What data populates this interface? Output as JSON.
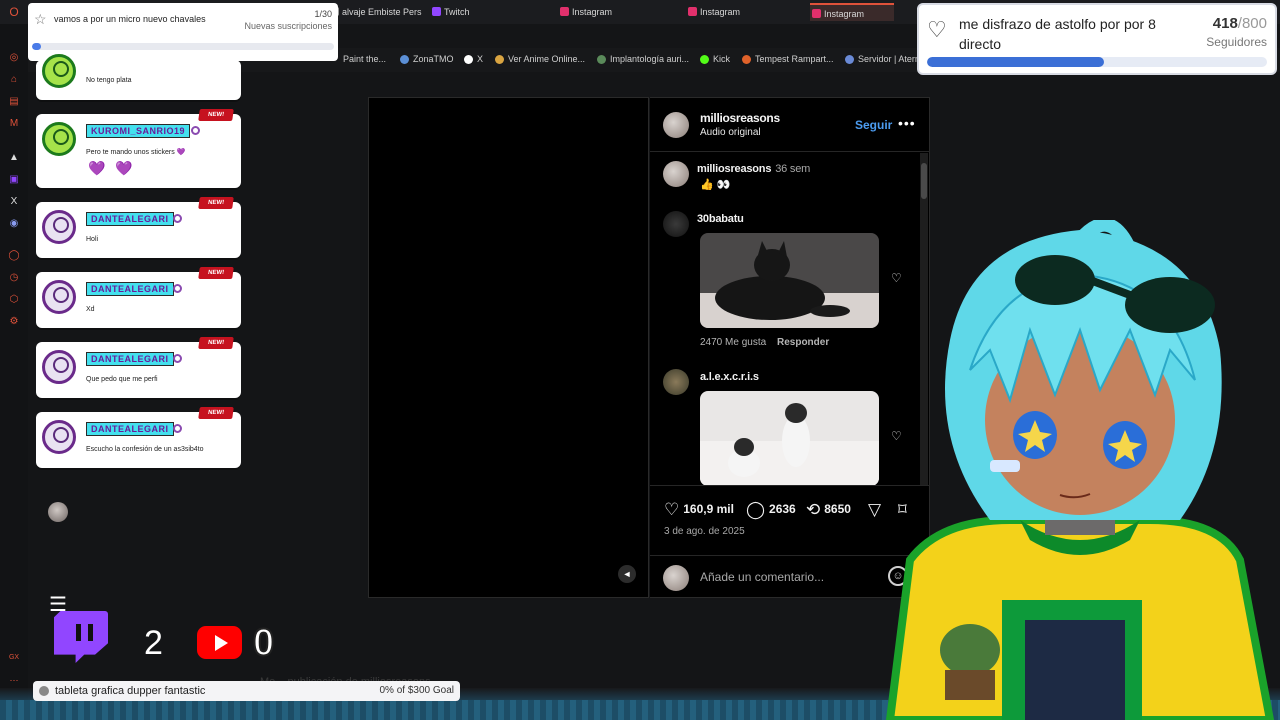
{
  "browser": {
    "tabs": [
      {
        "label": "alvaje Embiste Pers",
        "color": "#9a9a9a"
      },
      {
        "label": "Twitch",
        "color": "#9146ff"
      },
      {
        "label": "Instagram",
        "color": "#e1306c"
      },
      {
        "label": "Instagram",
        "color": "#e1306c"
      },
      {
        "label": "Instagram",
        "color": "#e1306c",
        "active": true
      }
    ],
    "bookmarks": [
      "Paint the...",
      "ZonaTMO",
      "X",
      "Ver Anime Online...",
      "Implantología auri...",
      "Kick",
      "Tempest Rampart...",
      "Servidor | Atern"
    ]
  },
  "follower_goal": {
    "title": "vamos a por un micro nuevo chavales",
    "count": "1/30",
    "subtitle": "Nuevas suscripciones",
    "progress": 0.03
  },
  "subs_goal": {
    "title": "me disfrazo de astolfo por por 8 directo",
    "current": "418",
    "total": "/800",
    "subtitle": "Seguidores",
    "progress": 0.52
  },
  "chat": {
    "new_badge": "NEW!",
    "messages": [
      {
        "user": "",
        "text": "No tengo plata"
      },
      {
        "user": "KUROMI_SANRIO19",
        "text": "Pero te mando unos stickers 💜",
        "extra": "💜 💜"
      },
      {
        "user": "DANTEALEGARI",
        "text": "Holi"
      },
      {
        "user": "DANTEALEGARI",
        "text": "Xd"
      },
      {
        "user": "DANTEALEGARI",
        "text": "Que pedo que me perfi"
      },
      {
        "user": "DANTEALEGARI",
        "text": "Escucho la confesión de un as3sib4to"
      }
    ]
  },
  "instagram": {
    "author": "milliosreasons",
    "audio": "Audio original",
    "follow": "Seguir",
    "more": "•••",
    "comments": [
      {
        "user": "milliosreasons",
        "meta": "36 sem",
        "text": "👍 👀"
      },
      {
        "user": "30babatu",
        "likes": "2470 Me gusta",
        "reply": "Responder"
      },
      {
        "user": "a.l.e.x.c.r.i.s"
      }
    ],
    "likes": "160,9 mil",
    "comments_count": "2636",
    "reposts": "8650",
    "date": "3 de ago. de 2025",
    "add_comment_placeholder": "Añade un comentario..."
  },
  "stats": {
    "twitch_count": "2",
    "youtube_count": "0"
  },
  "donation_goal": {
    "title": "tableta grafica dupper fantastic",
    "progress_text": "0% of $300 Goal"
  },
  "ghost_text": "Me... publicación de milliosreasons",
  "colors": {
    "accent_purple": "#9146ff",
    "youtube_red": "#ff0000",
    "ig_blue": "#4c9cf0",
    "goal_blue": "#3b6fd6"
  }
}
